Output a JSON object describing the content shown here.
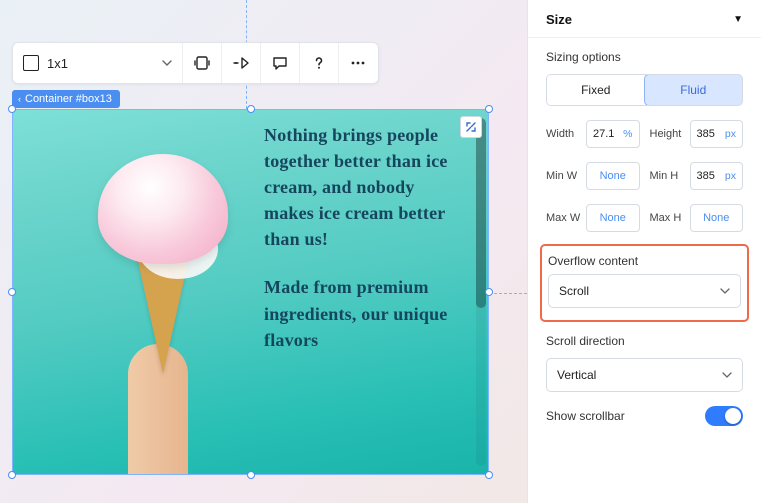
{
  "toolbar": {
    "ratio_label": "1x1"
  },
  "tag": {
    "label": "Container #box13"
  },
  "content": {
    "paragraph1": "Nothing brings people together better than ice cream, and nobody makes ice cream better than us!",
    "paragraph2": "Made from premium ingredients, our unique flavors"
  },
  "panel": {
    "header": "Size",
    "sizing_label": "Sizing options",
    "seg_fixed": "Fixed",
    "seg_fluid": "Fluid",
    "width_label": "Width",
    "width_value": "27.1",
    "width_unit": "%",
    "height_label": "Height",
    "height_value": "385",
    "height_unit": "px",
    "minw_label": "Min W",
    "minw_value": "None",
    "minh_label": "Min H",
    "minh_value": "385",
    "minh_unit": "px",
    "maxw_label": "Max W",
    "maxw_value": "None",
    "maxh_label": "Max H",
    "maxh_value": "None",
    "overflow_label": "Overflow content",
    "overflow_value": "Scroll",
    "scrolldir_label": "Scroll direction",
    "scrolldir_value": "Vertical",
    "showsb_label": "Show scrollbar"
  }
}
